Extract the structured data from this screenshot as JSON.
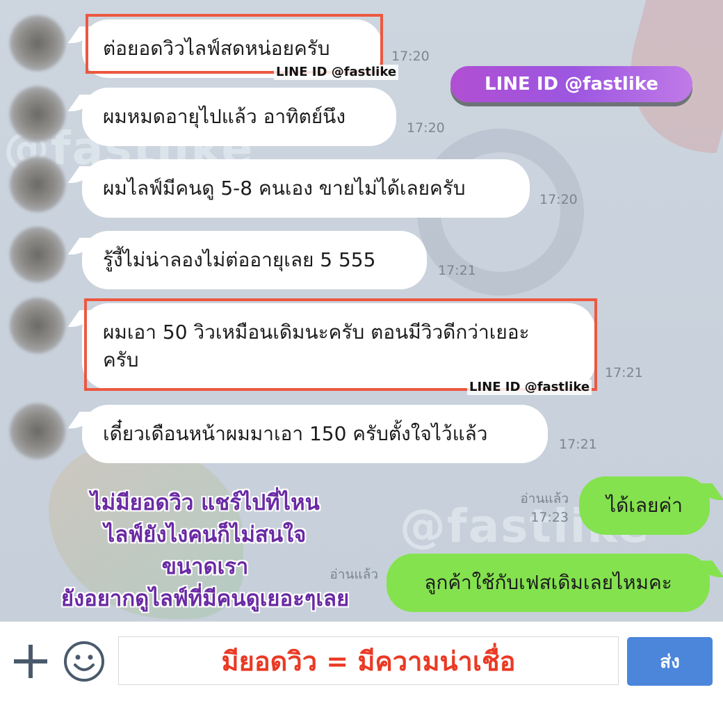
{
  "watermark": {
    "text": "@fastlike"
  },
  "messages": [
    {
      "text": "ต่อยอดวิวไลฟ์สดหน่อยครับ",
      "time": "17:20"
    },
    {
      "text": "ผมหมดอายุไปแล้ว อาทิตย์นึง",
      "time": "17:20"
    },
    {
      "text": "ผมไลฟ์มีคนดู 5-8 คนเอง ขายไม่ได้เลยครับ",
      "time": "17:20"
    },
    {
      "text": "รู้งี้ไม่น่าลองไม่ต่ออายุเลย 5 555",
      "time": "17:21"
    },
    {
      "text_line1": "ผมเอา 50 วิวเหมือนเดิมนะครับ ตอนมีวิวดีกว่าเยอะ",
      "text_line2": "ครับ",
      "time": "17:21"
    },
    {
      "text": "เดี๋ยวเดือนหน้าผมมาเอา 150 ครับตั้งใจไว้แล้ว",
      "time": "17:21"
    }
  ],
  "line_tags": [
    "LINE ID @fastlike",
    "LINE ID @fastlike"
  ],
  "line_pill": "LINE ID @fastlike",
  "replies": [
    {
      "text": "ได้เลยค่า",
      "read": "อ่านแล้ว",
      "time": "17:23"
    },
    {
      "text": "ลูกค้าใช้กับเฟสเดิมเลยไหมคะ",
      "read": "อ่านแล้ว"
    }
  ],
  "caption": [
    "ไม่มียอดวิว แชร์ไปที่ไหน",
    "ไลฟ์ยังไงคนก็ไม่สนใจ",
    "ขนาดเรา",
    "ยังอยากดูไลฟ์ที่มีคนดูเยอะๆเลย"
  ],
  "input": {
    "value": "มียอดวิว = มีความน่าเชื่อ"
  },
  "send_label": "ส่ง",
  "colors": {
    "highlight_box": "#ec5840",
    "own_bubble": "#84e24f",
    "send_button": "#4b86db",
    "caption_text": "#6a2aa3",
    "input_text": "#ea3a24"
  }
}
